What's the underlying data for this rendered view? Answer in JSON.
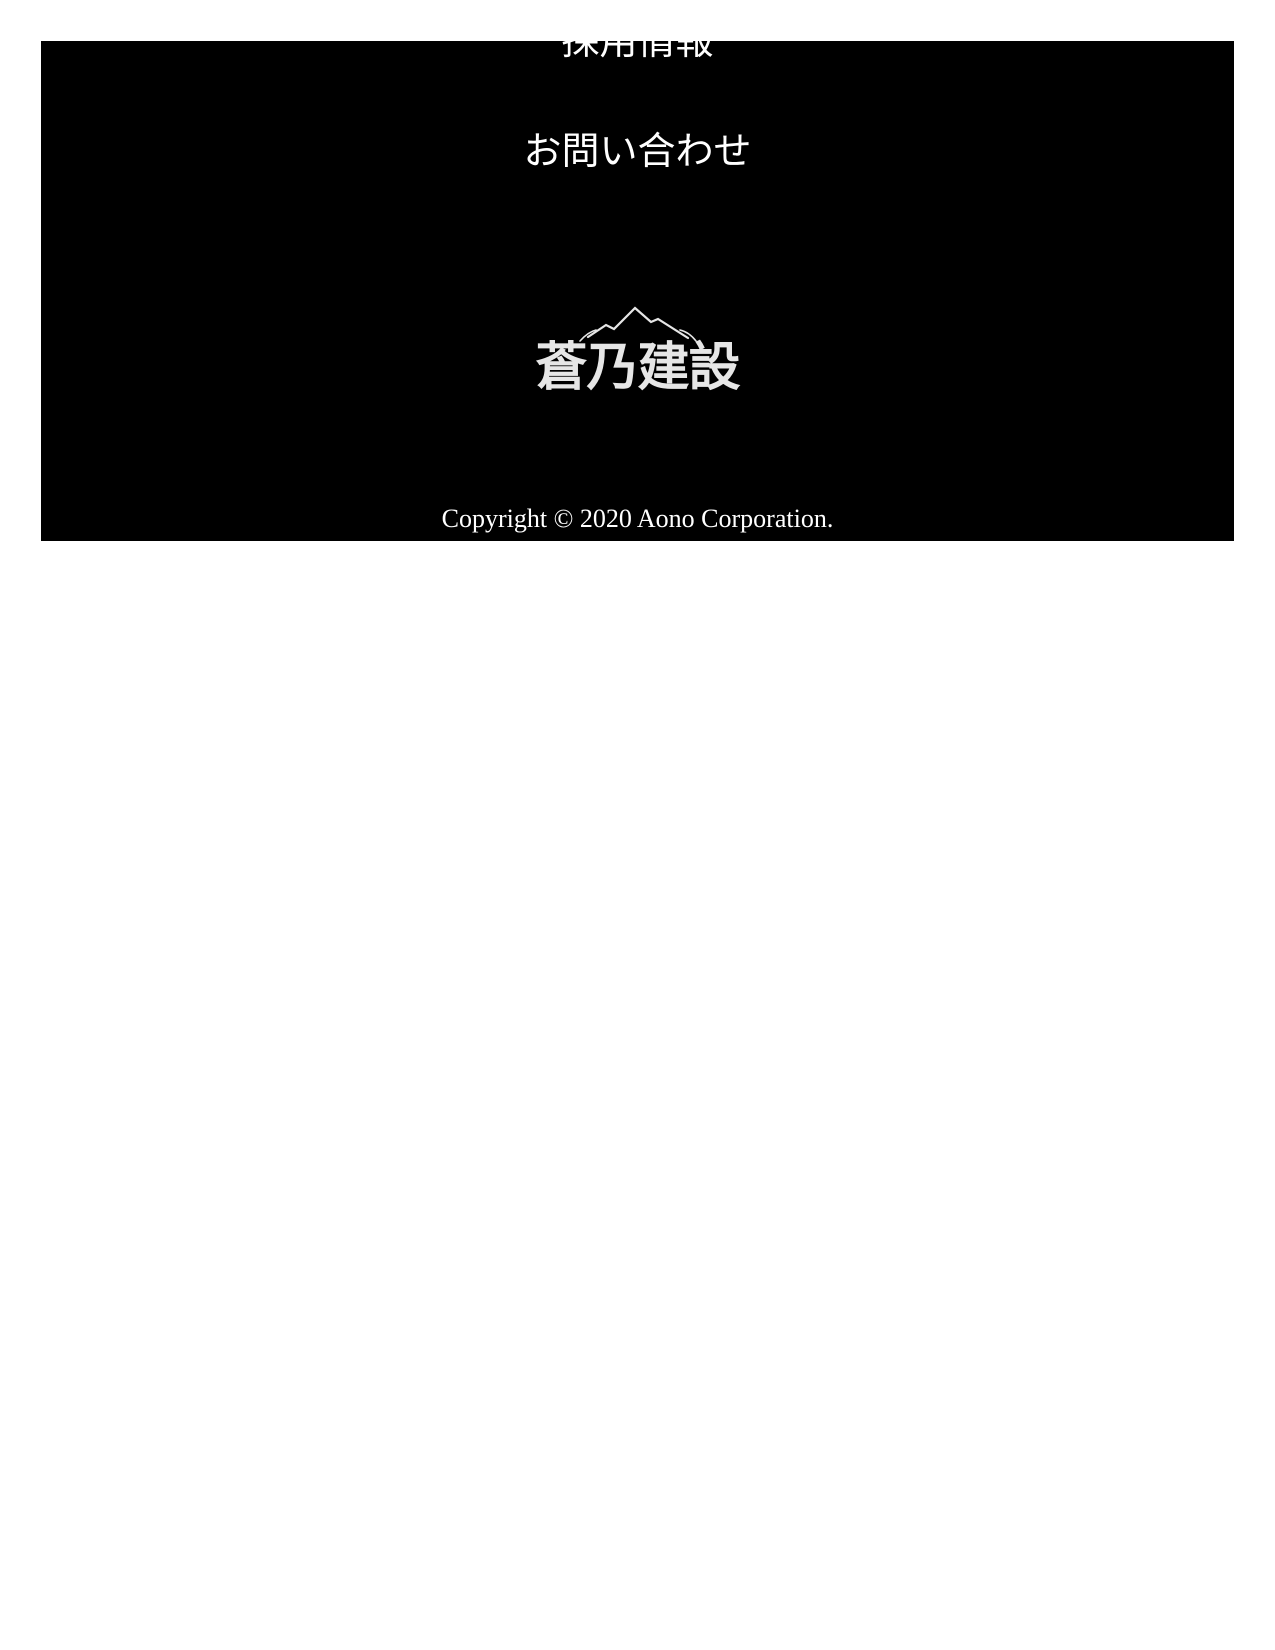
{
  "footer": {
    "nav": {
      "recruit_label": "採用情報",
      "contact_label": "お問い合わせ"
    },
    "logo": {
      "text": "蒼乃建設",
      "icon": "mountain-icon"
    },
    "copyright": "Copyright © 2020 Aono Corporation."
  },
  "colors": {
    "footer_background": "#000000",
    "text": "#ffffff",
    "page_background": "#ffffff"
  }
}
